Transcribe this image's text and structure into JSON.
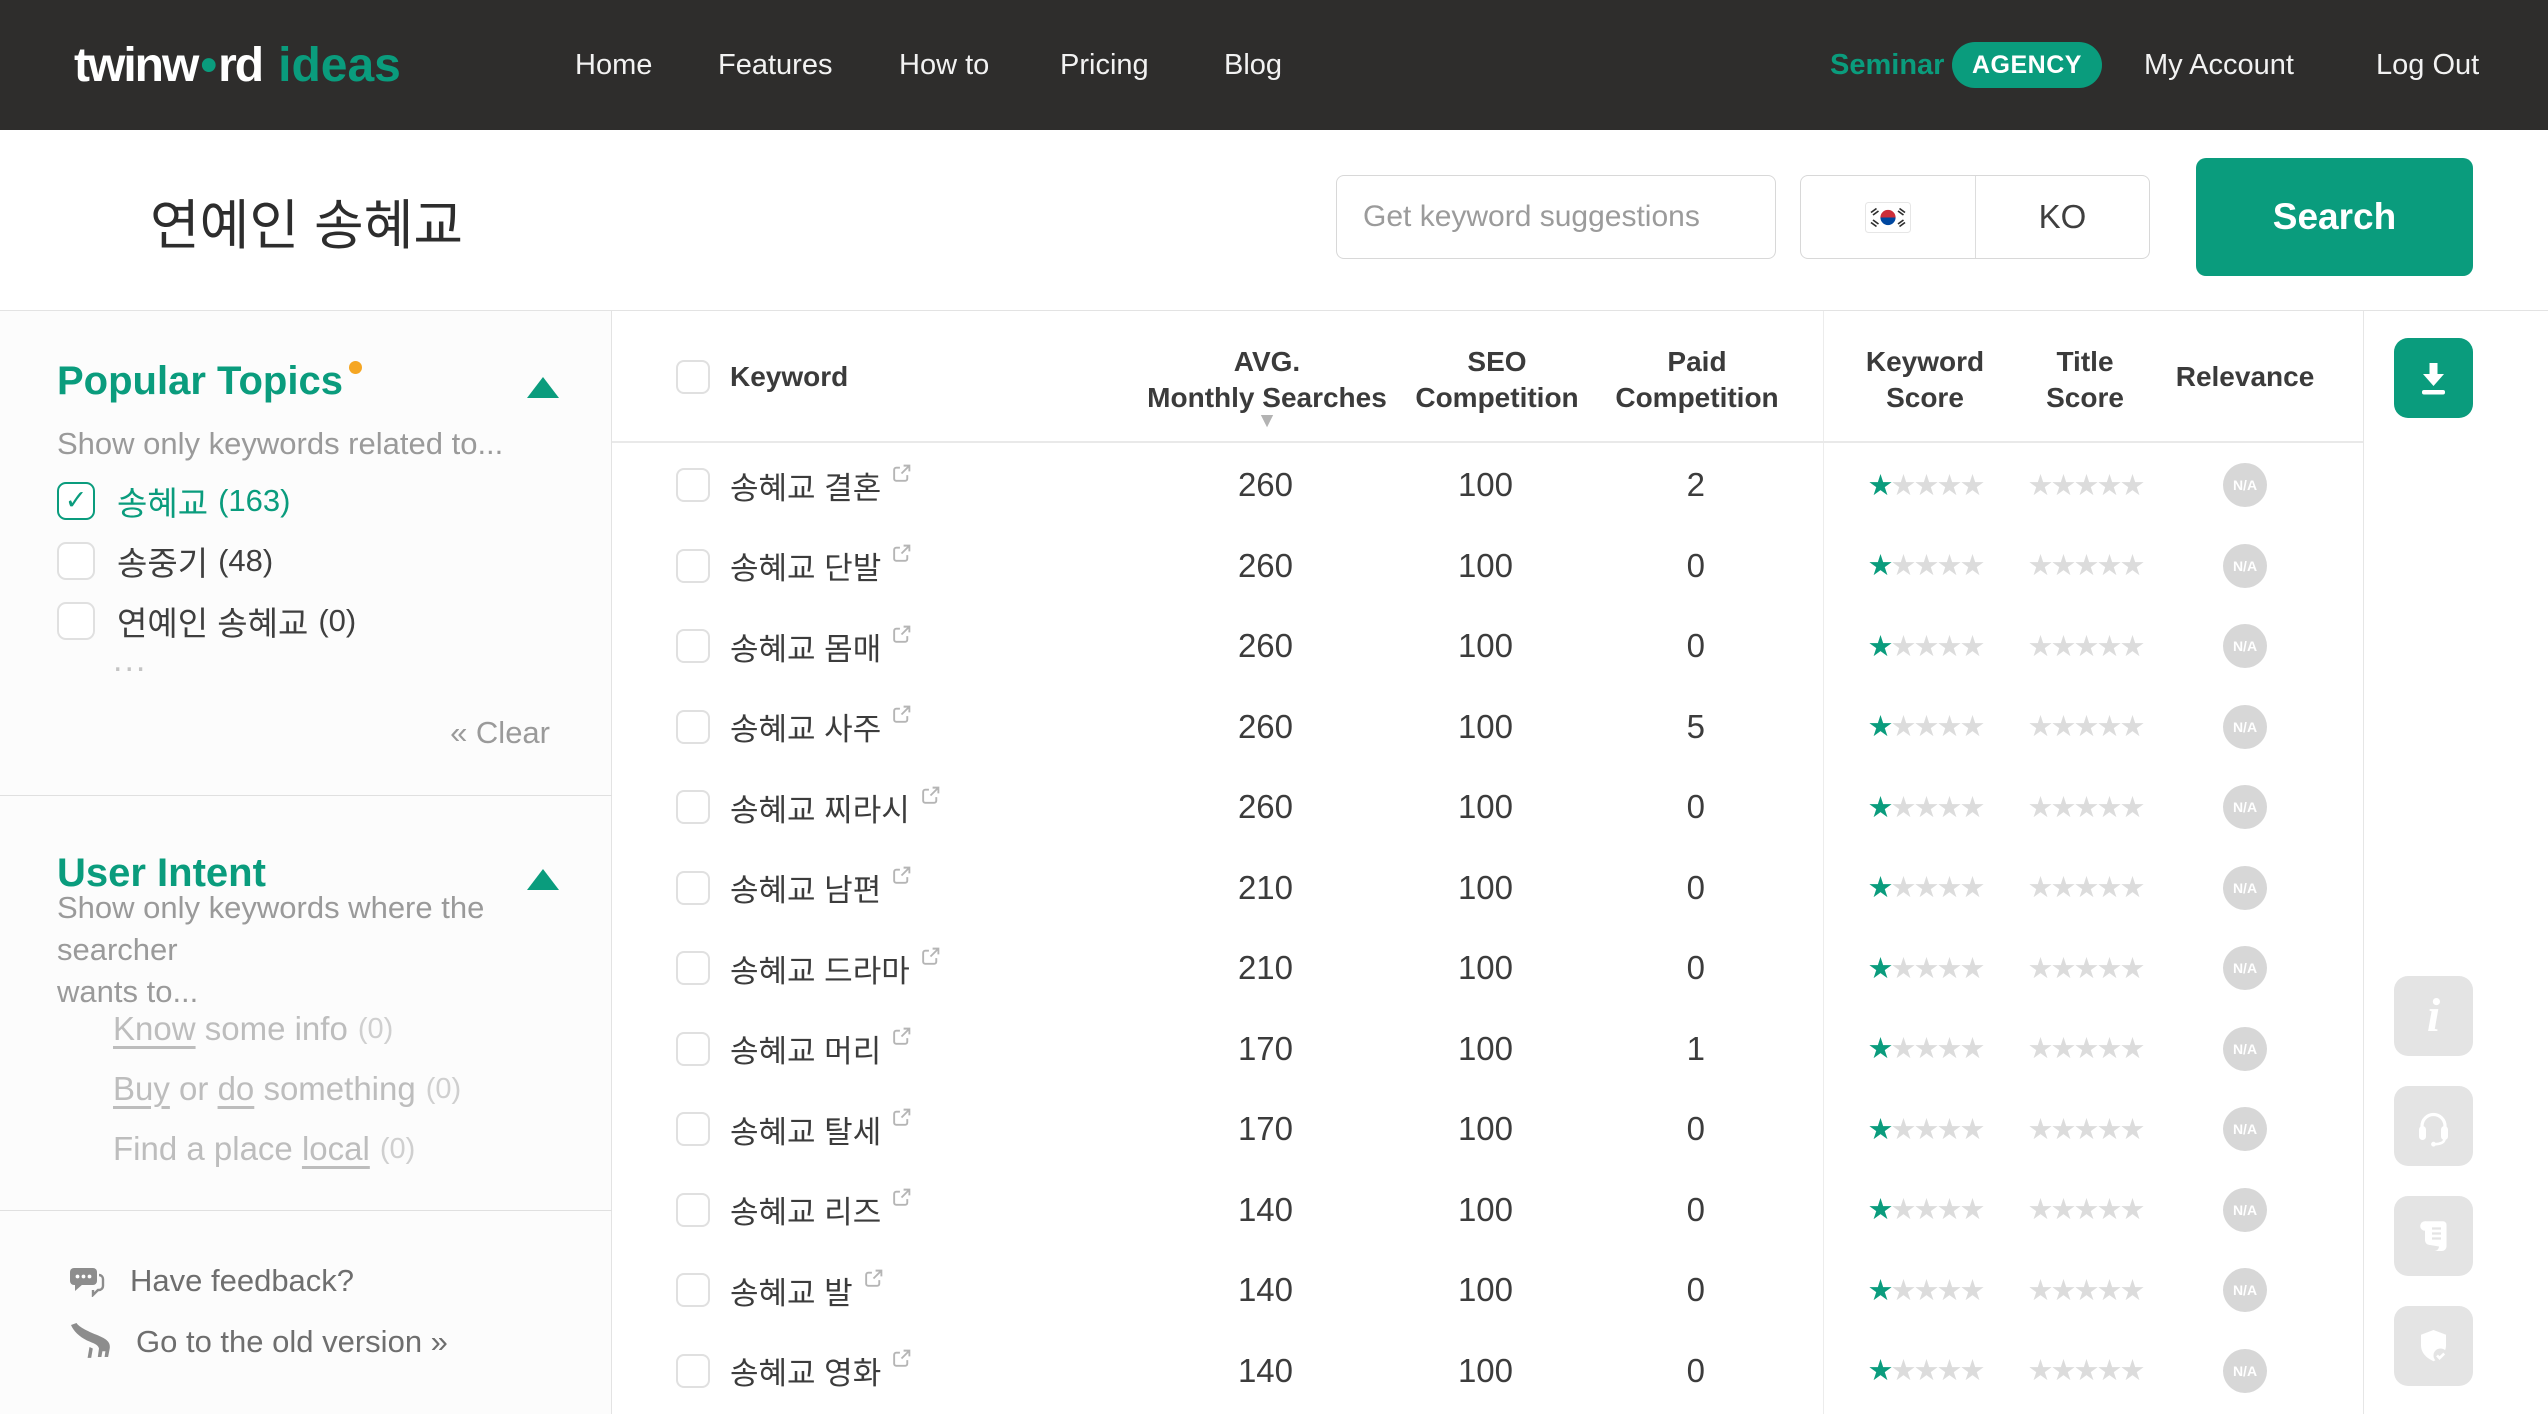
{
  "colors": {
    "brand": "#0a9c7d",
    "nav_bg": "#2e2d2c",
    "orange_dot": "#f5a623",
    "star_off": "#dcdcdc",
    "na_badge": "#d7d7d7",
    "fab_gray": "#e4e4e4"
  },
  "icons": {
    "logo_dot": "•",
    "star": "★",
    "sort_desc": "▼",
    "search": "magnifier-icon",
    "flag": "south-korea-flag-icon",
    "download": "download-icon",
    "info": "info-icon",
    "support": "headset-icon",
    "terms": "scroll-icon",
    "privacy": "shield-check-icon",
    "feedback": "speech-bubble-icon",
    "old_version": "dinosaur-icon",
    "external": "external-link-icon"
  },
  "nav": {
    "logo": {
      "word_start": "twinw",
      "word_end": "rd",
      "product": "ideas"
    },
    "items": [
      "Home",
      "Features",
      "How to",
      "Pricing",
      "Blog"
    ],
    "seminar": "Seminar",
    "agency_badge": "AGENCY",
    "my_account": "My Account",
    "log_out": "Log Out"
  },
  "search": {
    "query": "연예인 송혜교",
    "placeholder": "Get keyword suggestions",
    "language_code": "KO",
    "button": "Search"
  },
  "sidebar": {
    "popular_topics": {
      "title": "Popular Topics",
      "subtitle": "Show only keywords related to...",
      "topics": [
        {
          "label": "송혜교",
          "count": "(163)",
          "checked": true
        },
        {
          "label": "송중기",
          "count": "(48)",
          "checked": false
        },
        {
          "label": "연예인 송혜교",
          "count": "(0)",
          "checked": false
        }
      ],
      "more": "...",
      "clear": "« Clear"
    },
    "user_intent": {
      "title": "User Intent",
      "subtitle": "Show only keywords where the searcher\nwants to...",
      "items": [
        {
          "segments": [
            {
              "text": "Know",
              "underline": true
            },
            {
              "text": " some info",
              "underline": false
            }
          ],
          "count": "(0)"
        },
        {
          "segments": [
            {
              "text": "Buy",
              "underline": true
            },
            {
              "text": " or ",
              "underline": false
            },
            {
              "text": "do",
              "underline": true
            },
            {
              "text": " something",
              "underline": false
            }
          ],
          "count": "(0)"
        },
        {
          "segments": [
            {
              "text": "Find a place ",
              "underline": false
            },
            {
              "text": "local",
              "underline": true
            }
          ],
          "count": "(0)"
        }
      ]
    },
    "feedback": "Have feedback?",
    "old_version": "Go to the old version »"
  },
  "table": {
    "headers": {
      "keyword": "Keyword",
      "avg_line1": "AVG.",
      "avg_line2": "Monthly Searches",
      "seo_line1": "SEO",
      "seo_line2": "Competition",
      "paid_line1": "Paid",
      "paid_line2": "Competition",
      "kscore_line1": "Keyword",
      "kscore_line2": "Score",
      "tscore_line1": "Title",
      "tscore_line2": "Score",
      "relevance": "Relevance"
    },
    "sorted_by": "AVG. Monthly Searches (descending)",
    "rows": [
      {
        "keyword": "송혜교 결혼",
        "avg_monthly_searches": "260",
        "seo_competition": "100",
        "paid_competition": "2",
        "keyword_score": 1,
        "title_score": 0,
        "relevance": "N/A"
      },
      {
        "keyword": "송혜교 단발",
        "avg_monthly_searches": "260",
        "seo_competition": "100",
        "paid_competition": "0",
        "keyword_score": 1,
        "title_score": 0,
        "relevance": "N/A"
      },
      {
        "keyword": "송혜교 몸매",
        "avg_monthly_searches": "260",
        "seo_competition": "100",
        "paid_competition": "0",
        "keyword_score": 1,
        "title_score": 0,
        "relevance": "N/A"
      },
      {
        "keyword": "송혜교 사주",
        "avg_monthly_searches": "260",
        "seo_competition": "100",
        "paid_competition": "5",
        "keyword_score": 1,
        "title_score": 0,
        "relevance": "N/A"
      },
      {
        "keyword": "송혜교 찌라시",
        "avg_monthly_searches": "260",
        "seo_competition": "100",
        "paid_competition": "0",
        "keyword_score": 1,
        "title_score": 0,
        "relevance": "N/A"
      },
      {
        "keyword": "송혜교 남편",
        "avg_monthly_searches": "210",
        "seo_competition": "100",
        "paid_competition": "0",
        "keyword_score": 1,
        "title_score": 0,
        "relevance": "N/A"
      },
      {
        "keyword": "송혜교 드라마",
        "avg_monthly_searches": "210",
        "seo_competition": "100",
        "paid_competition": "0",
        "keyword_score": 1,
        "title_score": 0,
        "relevance": "N/A"
      },
      {
        "keyword": "송혜교 머리",
        "avg_monthly_searches": "170",
        "seo_competition": "100",
        "paid_competition": "1",
        "keyword_score": 1,
        "title_score": 0,
        "relevance": "N/A"
      },
      {
        "keyword": "송혜교 탈세",
        "avg_monthly_searches": "170",
        "seo_competition": "100",
        "paid_competition": "0",
        "keyword_score": 1,
        "title_score": 0,
        "relevance": "N/A"
      },
      {
        "keyword": "송혜교 리즈",
        "avg_monthly_searches": "140",
        "seo_competition": "100",
        "paid_competition": "0",
        "keyword_score": 1,
        "title_score": 0,
        "relevance": "N/A"
      },
      {
        "keyword": "송혜교 발",
        "avg_monthly_searches": "140",
        "seo_competition": "100",
        "paid_competition": "0",
        "keyword_score": 1,
        "title_score": 0,
        "relevance": "N/A"
      },
      {
        "keyword": "송혜교 영화",
        "avg_monthly_searches": "140",
        "seo_competition": "100",
        "paid_competition": "0",
        "keyword_score": 1,
        "title_score": 0,
        "relevance": "N/A"
      }
    ]
  }
}
